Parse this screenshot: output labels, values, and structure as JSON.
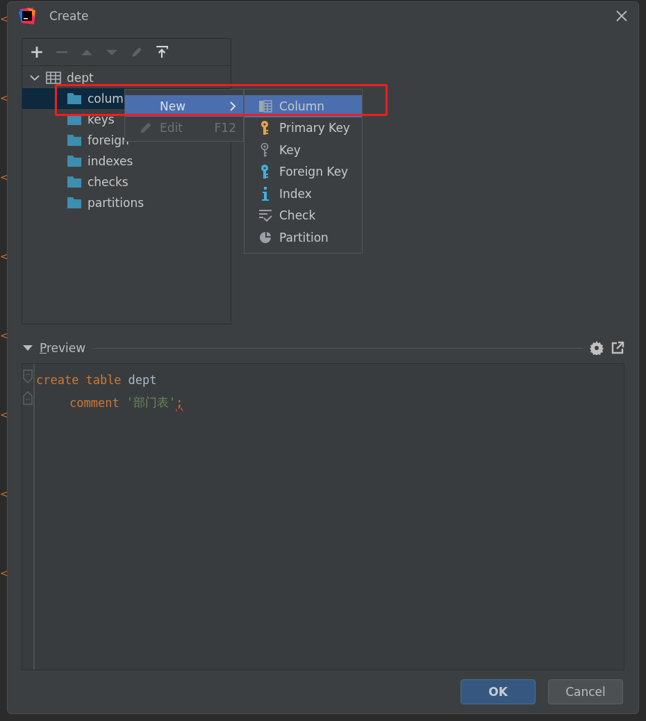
{
  "background_editor": {
    "marks": [
      "<",
      "<",
      "<",
      "<",
      "<",
      "<",
      "<",
      "<"
    ]
  },
  "window": {
    "title": "Create"
  },
  "toolbar": {
    "buttons": [
      {
        "kind": "add",
        "disabled": false
      },
      {
        "kind": "remove",
        "disabled": true
      },
      {
        "kind": "up",
        "disabled": true
      },
      {
        "kind": "down",
        "disabled": true
      },
      {
        "kind": "edit",
        "disabled": true
      },
      {
        "kind": "export",
        "disabled": false
      }
    ]
  },
  "tree": {
    "label": "dept",
    "expanded": true,
    "children": [
      {
        "label": "colum",
        "selected": true
      },
      {
        "label": "keys",
        "selected": false
      },
      {
        "label": "foreign",
        "selected": false
      },
      {
        "label": "indexes",
        "selected": false
      },
      {
        "label": "checks",
        "selected": false
      },
      {
        "label": "partitions",
        "selected": false
      }
    ]
  },
  "context_menu": {
    "items": [
      {
        "label": "New",
        "submenu": true,
        "disabled": false,
        "selected": true
      },
      {
        "label": "Edit",
        "shortcut": "F12",
        "submenu": false,
        "disabled": true,
        "selected": false
      }
    ]
  },
  "submenu": {
    "items": [
      {
        "label": "Column",
        "kind": "column",
        "selected": true
      },
      {
        "label": "Primary Key",
        "kind": "primary-key",
        "selected": false
      },
      {
        "label": "Key",
        "kind": "key",
        "selected": false
      },
      {
        "label": "Foreign Key",
        "kind": "foreign-key",
        "selected": false
      },
      {
        "label": "Index",
        "kind": "index",
        "selected": false
      },
      {
        "label": "Check",
        "kind": "check",
        "selected": false
      },
      {
        "label": "Partition",
        "kind": "partition",
        "selected": false
      }
    ]
  },
  "preview": {
    "title": "Preview",
    "expanded": true,
    "code": [
      {
        "indented": false,
        "tokens": [
          {
            "kind": "keyword",
            "text": "create"
          },
          {
            "kind": "keyword",
            "text": "table"
          },
          {
            "kind": "ident",
            "text": "dept"
          }
        ]
      },
      {
        "indented": true,
        "tokens": [
          {
            "kind": "keyword",
            "text": "comment"
          },
          {
            "kind": "string",
            "text": "'部门表'"
          },
          {
            "kind": "error",
            "text": ";"
          }
        ]
      }
    ]
  },
  "buttons": [
    {
      "label": "OK",
      "primary": true
    },
    {
      "label": "Cancel",
      "primary": false
    }
  ]
}
